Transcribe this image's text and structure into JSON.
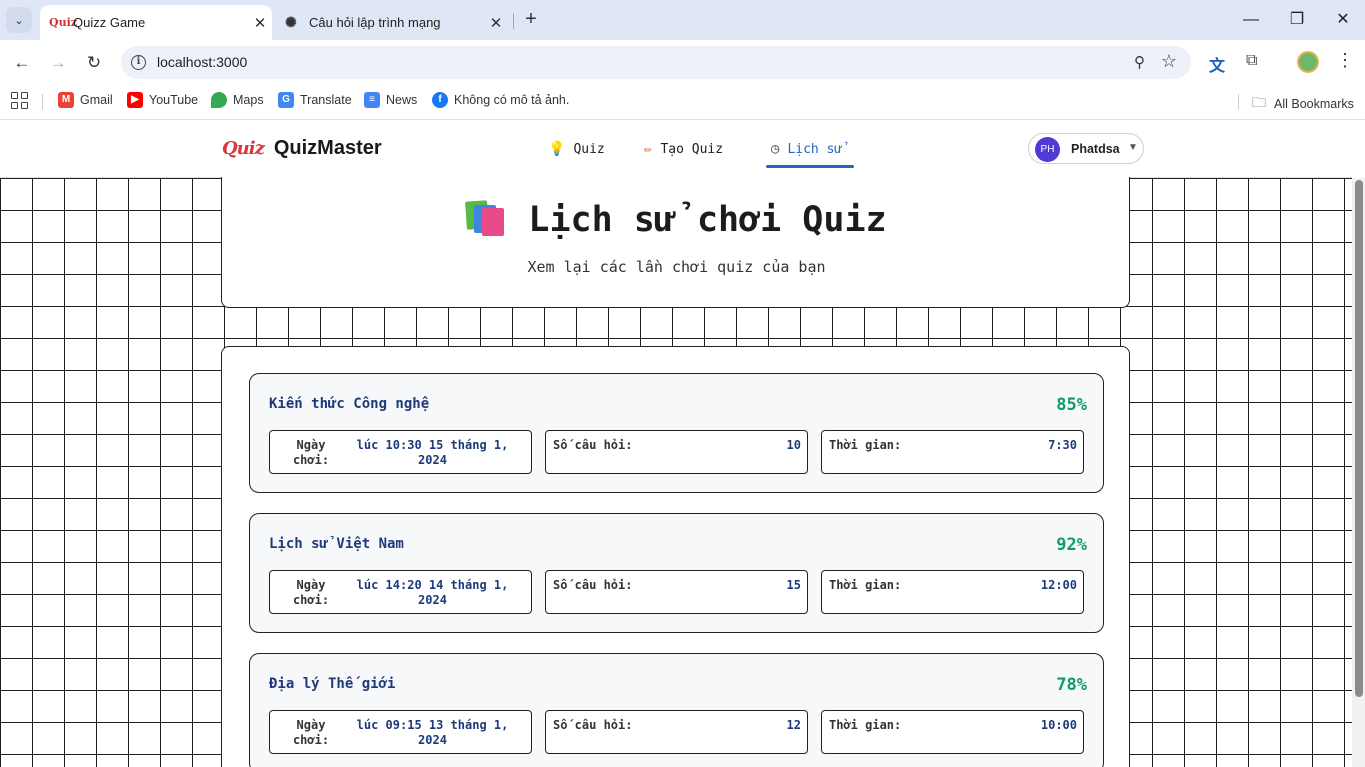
{
  "browser": {
    "tabs": [
      {
        "title": "Quizz Game",
        "favicon": "Quiz",
        "active": true
      },
      {
        "title": "Câu hỏi lập trình mạng",
        "favicon": "openai-icon",
        "active": false
      }
    ],
    "url": "localhost:3000",
    "bookmarks": [
      {
        "label": "Gmail",
        "icon": "gmail-icon",
        "color": "#ea4335"
      },
      {
        "label": "YouTube",
        "icon": "youtube-icon",
        "color": "#ff0000"
      },
      {
        "label": "Maps",
        "icon": "maps-icon",
        "color": "#34a853"
      },
      {
        "label": "Translate",
        "icon": "translate-icon",
        "color": "#4285f4"
      },
      {
        "label": "News",
        "icon": "news-icon",
        "color": "#4285f4"
      },
      {
        "label": "Không có mô tả ảnh.",
        "icon": "facebook-icon",
        "color": "#1877f2"
      }
    ],
    "all_bookmarks": "All Bookmarks"
  },
  "app": {
    "logo_text": "Quiz",
    "brand": "QuizMaster",
    "nav": [
      {
        "label": "Quiz",
        "icon": "lightbulb-icon",
        "active": false
      },
      {
        "label": "Tạo Quiz",
        "icon": "pencil-icon",
        "active": false
      },
      {
        "label": "Lịch sử",
        "icon": "clock-icon",
        "active": true
      }
    ],
    "user": {
      "initials": "PH",
      "name": "Phatdsa"
    },
    "accent_color": "#2563c9"
  },
  "hero": {
    "title": "Lịch sử chơi Quiz",
    "subtitle": "Xem lại các lần chơi quiz của bạn",
    "icon": "books-icon"
  },
  "history": {
    "labels": {
      "date": "Ngày chơi:",
      "questions": "Số câu hỏi:",
      "time": "Thời gian:"
    },
    "entries": [
      {
        "title": "Kiến thức Công nghệ",
        "score": "85%",
        "date": "lúc 10:30 15 tháng 1, 2024",
        "questions": "10",
        "time": "7:30"
      },
      {
        "title": "Lịch sử Việt Nam",
        "score": "92%",
        "date": "lúc 14:20 14 tháng 1, 2024",
        "questions": "15",
        "time": "12:00"
      },
      {
        "title": "Địa lý Thế giới",
        "score": "78%",
        "date": "lúc 09:15 13 tháng 1, 2024",
        "questions": "12",
        "time": "10:00"
      }
    ],
    "score_color": "#0f9a6c"
  }
}
